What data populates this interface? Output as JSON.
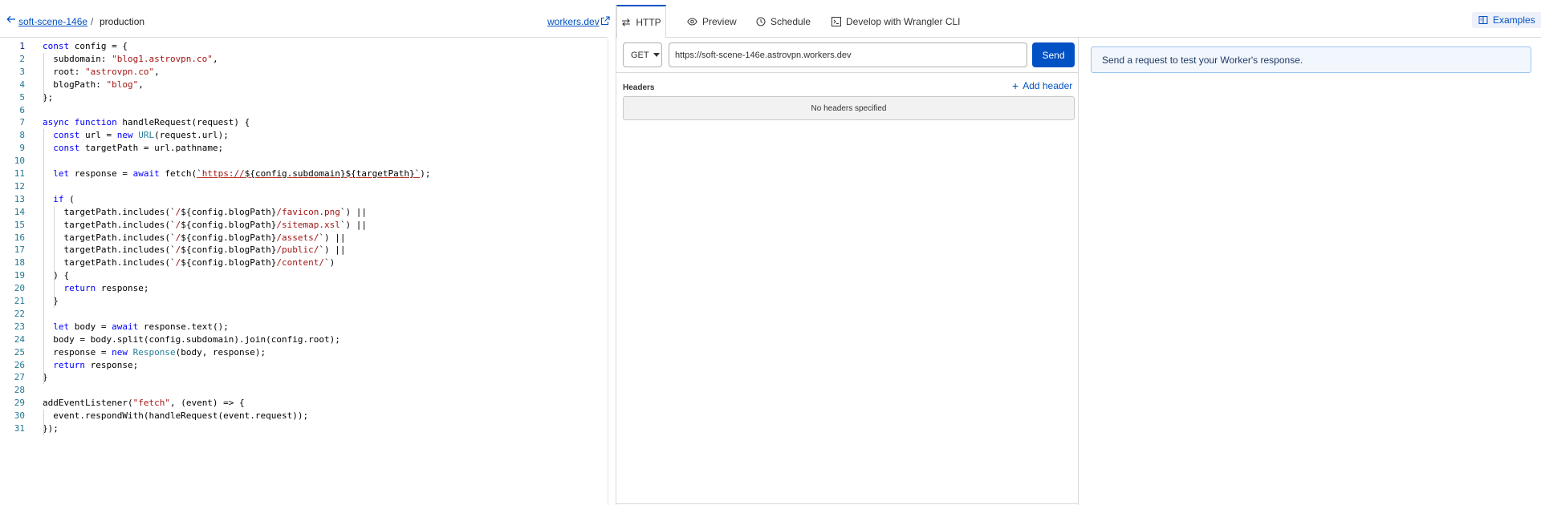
{
  "editor": {
    "back_icon": "arrow-left-icon",
    "script_name": "soft-scene-146e",
    "breadcrumb_separator": "/",
    "environment": "production",
    "workers_link": "workers.dev",
    "external_icon": "external-link-icon"
  },
  "code_lines": [
    {
      "n": "1",
      "html": "<span class=\"kw\">const</span> config = {"
    },
    {
      "n": "2",
      "html": "  subdomain: <span class=\"str\">\"blog1.astrovpn.co\"</span>,"
    },
    {
      "n": "3",
      "html": "  root: <span class=\"str\">\"astrovpn.co\"</span>,"
    },
    {
      "n": "4",
      "html": "  blogPath: <span class=\"str\">\"blog\"</span>,"
    },
    {
      "n": "5",
      "html": "};"
    },
    {
      "n": "6",
      "html": ""
    },
    {
      "n": "7",
      "html": "<span class=\"kw\">async</span> <span class=\"kw\">function</span> handleRequest(request) {"
    },
    {
      "n": "8",
      "html": "  <span class=\"kw\">const</span> url = <span class=\"kw\">new</span> <span class=\"cls\">URL</span>(request.url);"
    },
    {
      "n": "9",
      "html": "  <span class=\"kw\">const</span> targetPath = url.pathname;"
    },
    {
      "n": "10",
      "html": ""
    },
    {
      "n": "11",
      "html": "  <span class=\"kw\">let</span> response = <span class=\"kw\">await</span> fetch(<span class=\"sq\">`<span class=\"tpl\">https://</span>${config.subdomain}${targetPath}`</span>);"
    },
    {
      "n": "12",
      "html": ""
    },
    {
      "n": "13",
      "html": "  <span class=\"kw\">if</span> ("
    },
    {
      "n": "14",
      "html": "    targetPath.includes(`<span class=\"tpl\">/</span>${config.blogPath}<span class=\"tpl\">/favicon.png</span>`) ||"
    },
    {
      "n": "15",
      "html": "    targetPath.includes(`<span class=\"tpl\">/</span>${config.blogPath}<span class=\"tpl\">/sitemap.xsl</span>`) ||"
    },
    {
      "n": "16",
      "html": "    targetPath.includes(`<span class=\"tpl\">/</span>${config.blogPath}<span class=\"tpl\">/assets/</span>`) ||"
    },
    {
      "n": "17",
      "html": "    targetPath.includes(`<span class=\"tpl\">/</span>${config.blogPath}<span class=\"tpl\">/public/</span>`) ||"
    },
    {
      "n": "18",
      "html": "    targetPath.includes(`<span class=\"tpl\">/</span>${config.blogPath}<span class=\"tpl\">/content/</span>`)"
    },
    {
      "n": "19",
      "html": "  ) {"
    },
    {
      "n": "20",
      "html": "    <span class=\"kw\">return</span> response;"
    },
    {
      "n": "21",
      "html": "  }"
    },
    {
      "n": "22",
      "html": ""
    },
    {
      "n": "23",
      "html": "  <span class=\"kw\">let</span> body = <span class=\"kw\">await</span> response.text();"
    },
    {
      "n": "24",
      "html": "  body = body.split(config.subdomain).join(config.root);"
    },
    {
      "n": "25",
      "html": "  response = <span class=\"kw\">new</span> <span class=\"cls\">Response</span>(body, response);"
    },
    {
      "n": "26",
      "html": "  <span class=\"kw\">return</span> response;"
    },
    {
      "n": "27",
      "html": "}"
    },
    {
      "n": "28",
      "html": ""
    },
    {
      "n": "29",
      "html": "addEventListener(<span class=\"str\">\"fetch\"</span>, (event) => {"
    },
    {
      "n": "30",
      "html": "  event.respondWith(handleRequest(event.request));"
    },
    {
      "n": "31",
      "html": "});"
    }
  ],
  "tabs": [
    {
      "label": "HTTP",
      "icon": "swap-arrows-icon",
      "active": true
    },
    {
      "label": "Preview",
      "icon": "eye-icon",
      "active": false
    },
    {
      "label": "Schedule",
      "icon": "clock-icon",
      "active": false
    },
    {
      "label": "Develop with Wrangler CLI",
      "icon": "terminal-icon",
      "active": false
    }
  ],
  "examples": {
    "label": "Examples",
    "icon": "book-icon"
  },
  "request": {
    "method": "GET",
    "url": "https://soft-scene-146e.astrovpn.workers.dev",
    "send_label": "Send",
    "headers_label": "Headers",
    "add_header_label": "Add header",
    "no_headers": "No headers specified"
  },
  "response": {
    "message": "Send a request to test your Worker's response."
  },
  "colors": {
    "accent": "#0051c3",
    "keyword": "#0000ff",
    "string": "#a31515",
    "class": "#267f99",
    "line_number": "#237893"
  }
}
